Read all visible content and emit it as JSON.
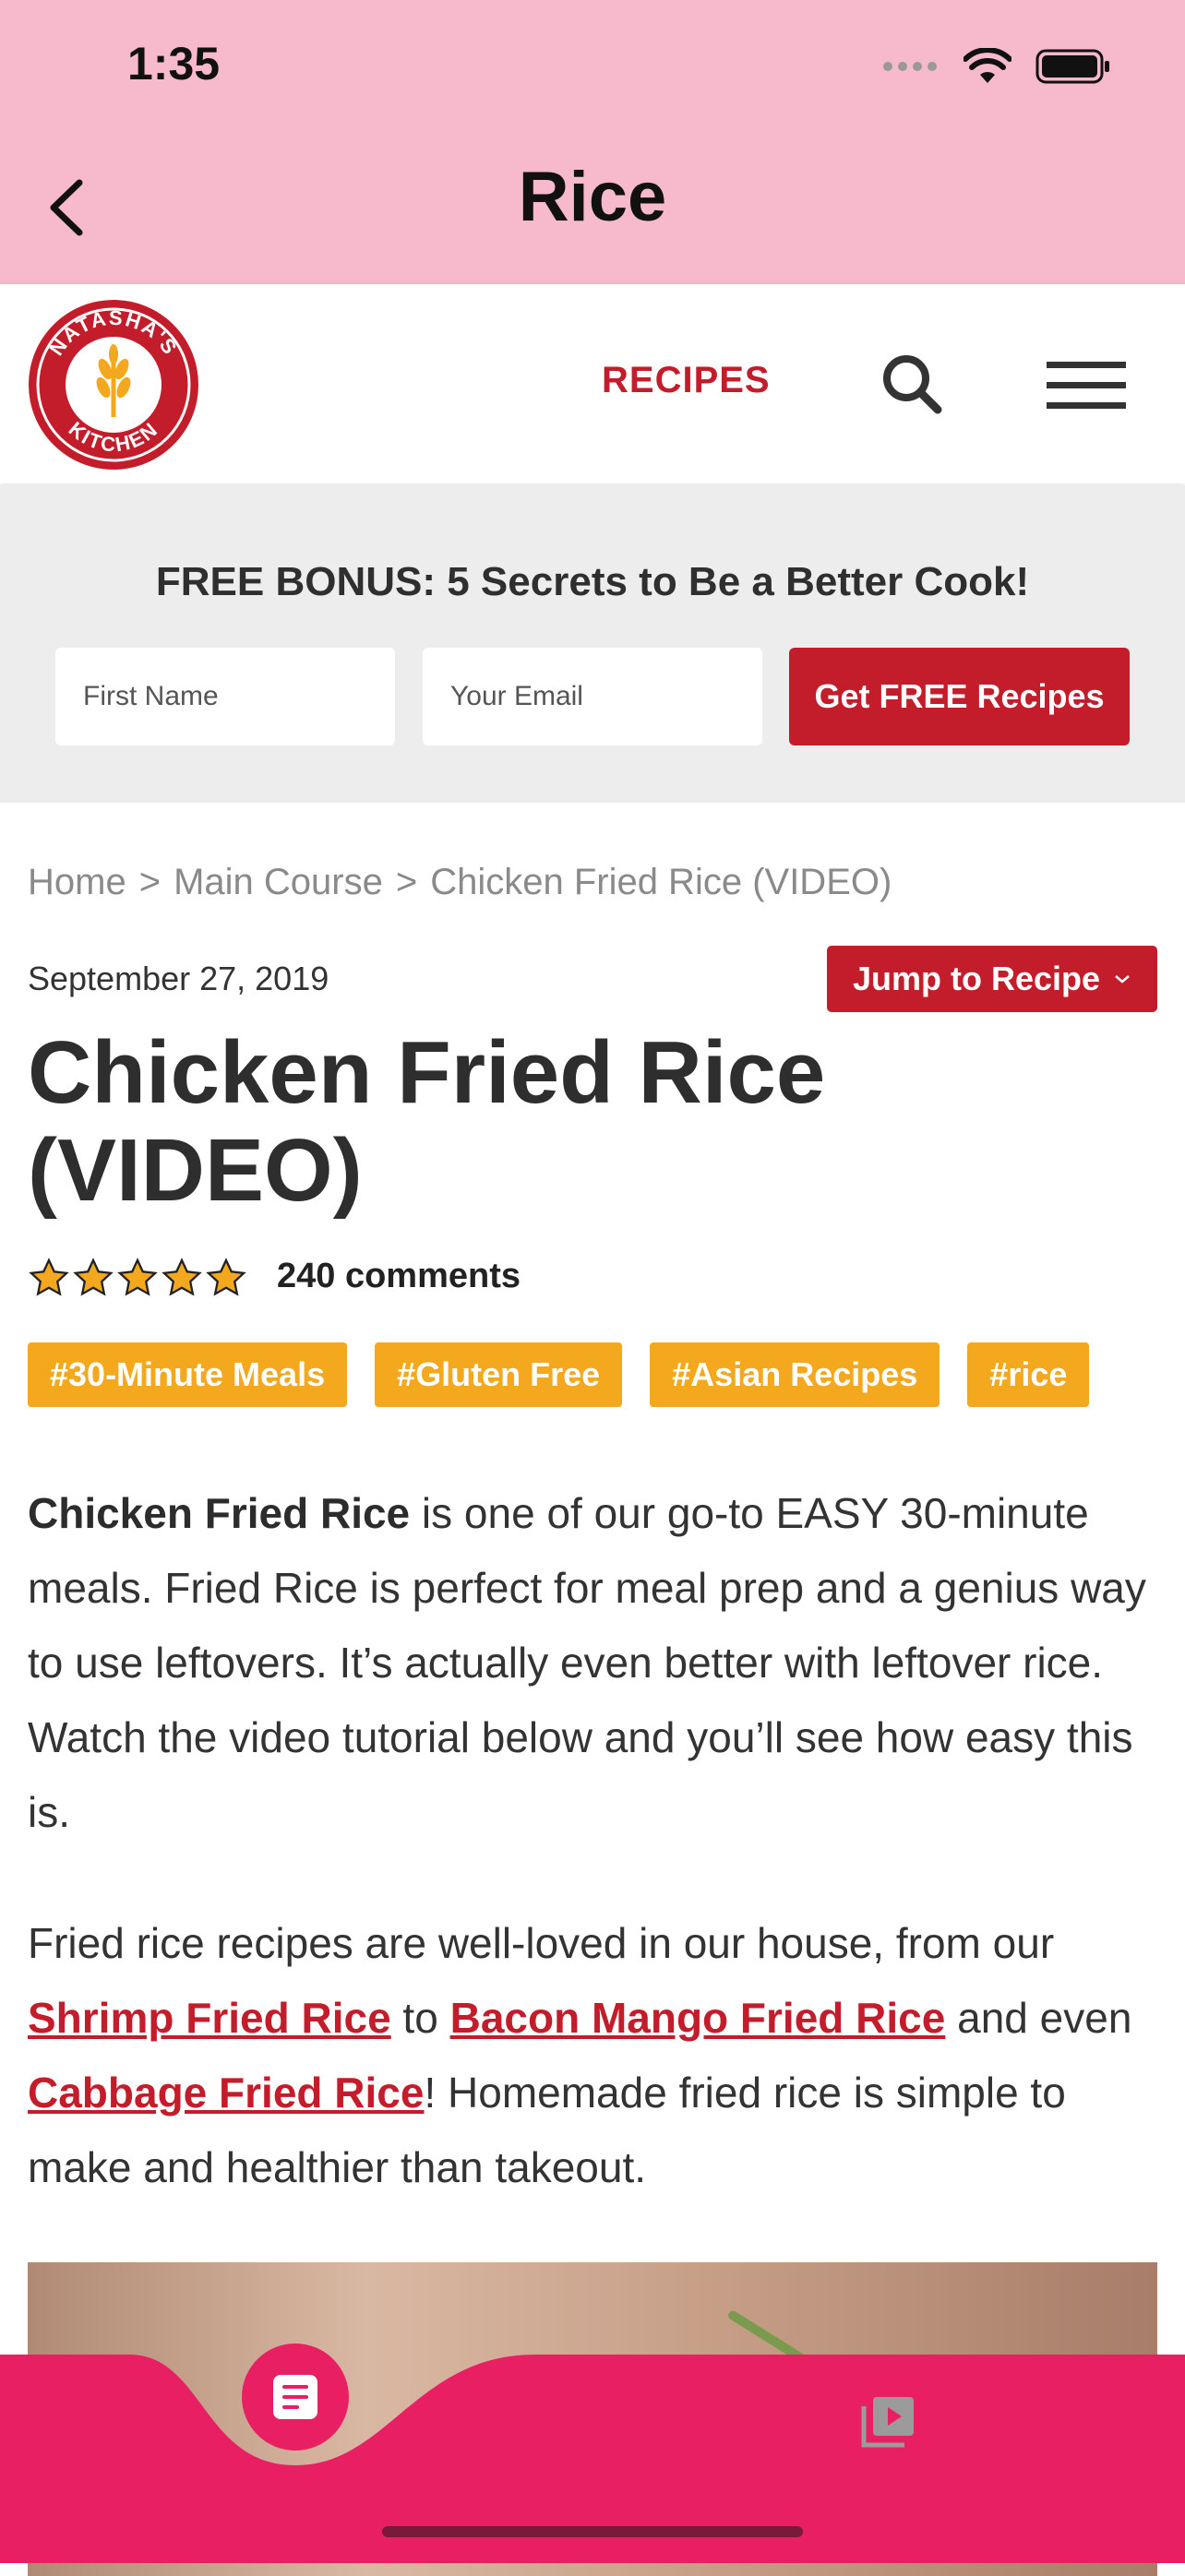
{
  "status_bar": {
    "time": "1:35"
  },
  "app_header": {
    "title": "Rice",
    "back_icon": "chevron-left-icon"
  },
  "site_header": {
    "logo_text_top": "NATASHA'S",
    "logo_text_bottom": "KITCHEN",
    "nav_recipes": "RECIPES",
    "search_icon": "search-icon",
    "menu_icon": "hamburger-menu-icon"
  },
  "bonus": {
    "title": "FREE BONUS: 5 Secrets to Be a Better Cook!",
    "first_name_placeholder": "First Name",
    "email_placeholder": "Your Email",
    "button_label": "Get FREE Recipes"
  },
  "breadcrumb": {
    "items": [
      "Home",
      "Main Course",
      "Chicken Fried Rice (VIDEO)"
    ],
    "separator": ">"
  },
  "post": {
    "date": "September 27, 2019",
    "jump_label": "Jump to Recipe",
    "title": "Chicken Fried Rice (VIDEO)",
    "rating_stars": 5,
    "comments": "240 comments",
    "tags": [
      "#30-Minute Meals",
      "#Gluten Free",
      "#Asian Recipes",
      "#rice"
    ],
    "para1_bold": "Chicken Fried Rice",
    "para1_rest": " is one of our go-to EASY 30-minute meals. Fried Rice is perfect for meal prep and a genius way to use leftovers. It’s actually even better with leftover rice. Watch the video tutorial below and you’ll see how easy this is.",
    "para2_a": "Fried rice recipes are well-loved in our house, from our ",
    "link1": "Shrimp Fried Rice",
    "para2_b": " to ",
    "link2": "Bacon Mango Fried Rice",
    "para2_c": " and even ",
    "link3": "Cabbage Fried Rice",
    "para2_d": "! Homemade fried rice is simple to make and healthier than takeout."
  },
  "tab_bar": {
    "active_tab_icon": "article-icon",
    "video_tab_icon": "video-library-icon"
  },
  "colors": {
    "app_header_bg": "#f7b9cc",
    "brand_red": "#c31d2b",
    "tag_orange": "#f4a81d",
    "tab_bar_pink": "#e91f63",
    "star_gold": "#f4a81d"
  }
}
